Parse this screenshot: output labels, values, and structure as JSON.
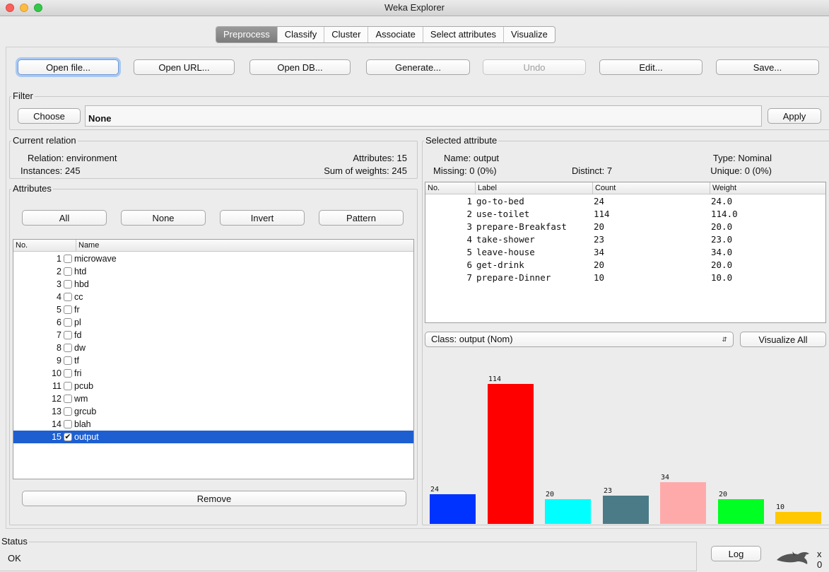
{
  "window": {
    "title": "Weka Explorer"
  },
  "tabs": [
    "Preprocess",
    "Classify",
    "Cluster",
    "Associate",
    "Select attributes",
    "Visualize"
  ],
  "toolbar": {
    "open_file": "Open file...",
    "open_url": "Open URL...",
    "open_db": "Open DB...",
    "generate": "Generate...",
    "undo": "Undo",
    "edit": "Edit...",
    "save": "Save..."
  },
  "filter": {
    "label": "Filter",
    "choose": "Choose",
    "value": "None",
    "apply": "Apply"
  },
  "current_relation": {
    "label": "Current relation",
    "relation": "Relation: environment",
    "instances": "Instances: 245",
    "attributes": "Attributes: 15",
    "sum_weights": "Sum of weights: 245"
  },
  "attributes_panel": {
    "label": "Attributes",
    "all": "All",
    "none": "None",
    "invert": "Invert",
    "pattern": "Pattern",
    "col_no": "No.",
    "col_name": "Name",
    "remove": "Remove",
    "rows": [
      {
        "no": "1",
        "name": "microwave",
        "checked": false
      },
      {
        "no": "2",
        "name": "htd",
        "checked": false
      },
      {
        "no": "3",
        "name": "hbd",
        "checked": false
      },
      {
        "no": "4",
        "name": "cc",
        "checked": false
      },
      {
        "no": "5",
        "name": "fr",
        "checked": false
      },
      {
        "no": "6",
        "name": "pl",
        "checked": false
      },
      {
        "no": "7",
        "name": "fd",
        "checked": false
      },
      {
        "no": "8",
        "name": "dw",
        "checked": false
      },
      {
        "no": "9",
        "name": "tf",
        "checked": false
      },
      {
        "no": "10",
        "name": "fri",
        "checked": false
      },
      {
        "no": "11",
        "name": "pcub",
        "checked": false
      },
      {
        "no": "12",
        "name": "wm",
        "checked": false
      },
      {
        "no": "13",
        "name": "grcub",
        "checked": false
      },
      {
        "no": "14",
        "name": "blah",
        "checked": false
      },
      {
        "no": "15",
        "name": "output",
        "checked": true
      }
    ]
  },
  "selected_attribute": {
    "label": "Selected attribute",
    "name": "Name: output",
    "type": "Type: Nominal",
    "missing": "Missing: 0 (0%)",
    "distinct": "Distinct: 7",
    "unique": "Unique: 0 (0%)",
    "col_no": "No.",
    "col_label": "Label",
    "col_count": "Count",
    "col_weight": "Weight",
    "rows": [
      {
        "no": "1",
        "label": "go-to-bed",
        "count": "24",
        "weight": "24.0"
      },
      {
        "no": "2",
        "label": "use-toilet",
        "count": "114",
        "weight": "114.0"
      },
      {
        "no": "3",
        "label": "prepare-Breakfast",
        "count": "20",
        "weight": "20.0"
      },
      {
        "no": "4",
        "label": "take-shower",
        "count": "23",
        "weight": "23.0"
      },
      {
        "no": "5",
        "label": "leave-house",
        "count": "34",
        "weight": "34.0"
      },
      {
        "no": "6",
        "label": "get-drink",
        "count": "20",
        "weight": "20.0"
      },
      {
        "no": "7",
        "label": "prepare-Dinner",
        "count": "10",
        "weight": "10.0"
      }
    ]
  },
  "class_select": {
    "value": "Class: output (Nom)",
    "visualize_all": "Visualize All"
  },
  "status": {
    "label": "Status",
    "text": "OK",
    "log": "Log",
    "x_label": "x 0"
  },
  "colors": {
    "selection": "#1d5fd1",
    "bars": [
      "#0033ff",
      "#ff0000",
      "#00ffff",
      "#4a7b86",
      "#ffaaaa",
      "#00ff22",
      "#ffc800"
    ]
  },
  "chart_data": {
    "type": "bar",
    "categories": [
      "go-to-bed",
      "use-toilet",
      "prepare-Breakfast",
      "take-shower",
      "leave-house",
      "get-drink",
      "prepare-Dinner"
    ],
    "values": [
      24,
      114,
      20,
      23,
      34,
      20,
      10
    ],
    "data_labels": [
      "24",
      "114",
      "20",
      "23",
      "34",
      "20",
      "10"
    ],
    "title": "",
    "xlabel": "",
    "ylabel": "",
    "ylim": [
      0,
      114
    ],
    "grid": false
  }
}
